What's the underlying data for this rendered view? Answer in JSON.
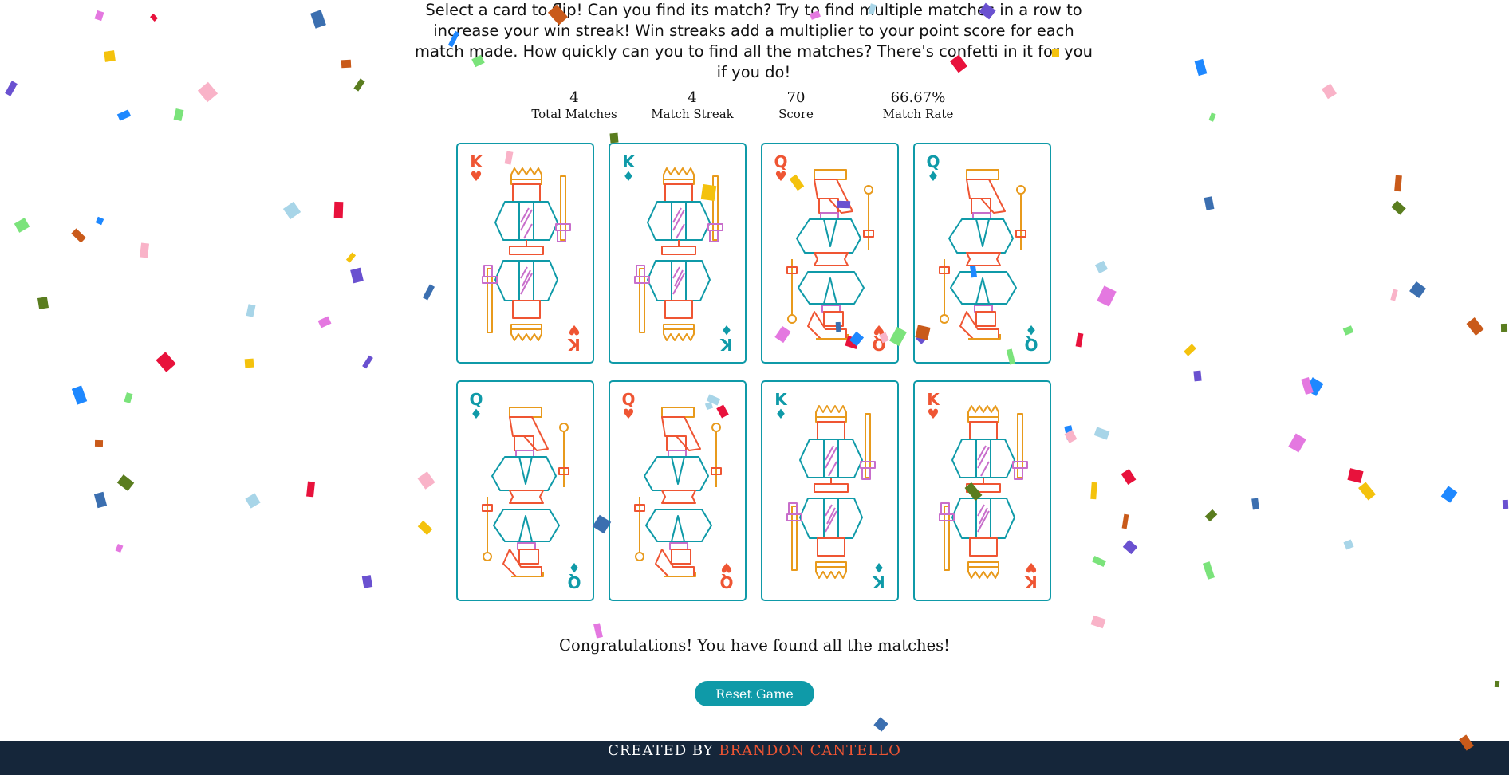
{
  "instructions": "Select a card to flip! Can you find its match? Try to find multiple matches in a row to increase your win streak! Win streaks add a multiplier to your point score for each match made. How quickly can you to find all the matches? There's confetti in it for you if you do!",
  "stats": {
    "total_matches": {
      "value": "4",
      "label": "Total Matches"
    },
    "match_streak": {
      "value": "4",
      "label": "Match Streak"
    },
    "score": {
      "value": "70",
      "label": "Score"
    },
    "match_rate": {
      "value": "66.67%",
      "label": "Match Rate"
    }
  },
  "colors": {
    "heart_red": "#ef5533",
    "diamond_teal": "#0f9aa8",
    "gold": "#e89a1c",
    "purple": "#c86ecb",
    "footer_bg": "#15263a"
  },
  "cards": [
    {
      "rank": "K",
      "suit": "♥",
      "suit_name": "hearts",
      "face": "king"
    },
    {
      "rank": "K",
      "suit": "♦",
      "suit_name": "diamonds",
      "face": "king"
    },
    {
      "rank": "Q",
      "suit": "♥",
      "suit_name": "hearts",
      "face": "queen"
    },
    {
      "rank": "Q",
      "suit": "♦",
      "suit_name": "diamonds",
      "face": "queen"
    },
    {
      "rank": "Q",
      "suit": "♦",
      "suit_name": "diamonds",
      "face": "queen"
    },
    {
      "rank": "Q",
      "suit": "♥",
      "suit_name": "hearts",
      "face": "queen"
    },
    {
      "rank": "K",
      "suit": "♦",
      "suit_name": "diamonds",
      "face": "king"
    },
    {
      "rank": "K",
      "suit": "♥",
      "suit_name": "hearts",
      "face": "king"
    }
  ],
  "message": "Congratulations! You have found all the matches!",
  "reset_button": "Reset Game",
  "footer": {
    "prefix": "CREATED BY",
    "author": "BRANDON CANTELLO"
  }
}
